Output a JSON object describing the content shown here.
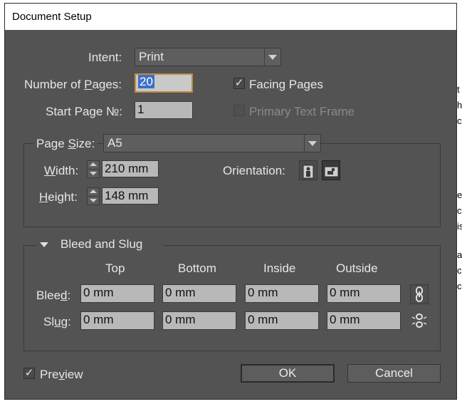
{
  "dialog": {
    "title": "Document Setup"
  },
  "intent": {
    "label": "Intent:",
    "value": "Print"
  },
  "pages": {
    "label": "Number of Pages:",
    "value": "20"
  },
  "start_page": {
    "label": "Start Page №:",
    "value": "1"
  },
  "facing_pages": {
    "label": "Facing Pages",
    "checked": true
  },
  "primary_text_frame": {
    "label": "Primary Text Frame",
    "checked": false,
    "enabled": false
  },
  "page_size": {
    "label": "Page Size:",
    "value": "A5"
  },
  "width": {
    "label": "Width:",
    "value": "210 mm"
  },
  "height": {
    "label": "Height:",
    "value": "148 mm"
  },
  "orientation": {
    "label": "Orientation:",
    "options": [
      "portrait",
      "landscape"
    ],
    "selected": "landscape"
  },
  "bleed_slug": {
    "title": "Bleed and Slug",
    "columns": [
      "Top",
      "Bottom",
      "Inside",
      "Outside"
    ],
    "bleed": {
      "label": "Bleed:",
      "values": [
        "0 mm",
        "0 mm",
        "0 mm",
        "0 mm"
      ]
    },
    "slug": {
      "label": "Slug:",
      "values": [
        "0 mm",
        "0 mm",
        "0 mm",
        "0 mm"
      ]
    }
  },
  "preview": {
    "label": "Preview",
    "checked": true
  },
  "buttons": {
    "ok": "OK",
    "cancel": "Cancel"
  },
  "background_letters": [
    "t",
    "h",
    "c",
    "e",
    "c",
    "is",
    "as",
    "c",
    "c"
  ]
}
